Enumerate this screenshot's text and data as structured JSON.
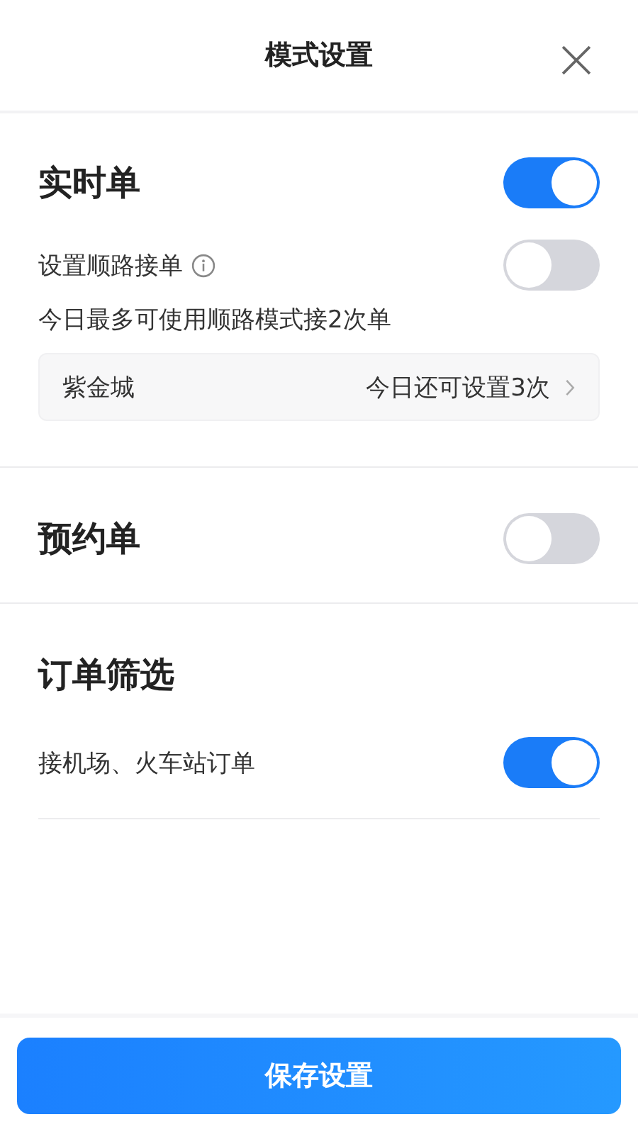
{
  "header": {
    "title": "模式设置"
  },
  "sections": [
    {
      "title": "实时单",
      "on": true,
      "rows": [
        {
          "kind": "toggle",
          "label": "设置顺路接单",
          "info": true,
          "on": false
        },
        {
          "kind": "note",
          "text": "今日最多可使用顺路模式接2次单"
        },
        {
          "kind": "link",
          "label": "紫金城",
          "value": "今日还可设置3次"
        }
      ]
    },
    {
      "title": "预约单",
      "on": false
    },
    {
      "title": "订单筛选",
      "rows": [
        {
          "kind": "toggle",
          "label": "接机场、火车站订单",
          "on": true
        }
      ]
    }
  ],
  "save_button": "保存设置"
}
